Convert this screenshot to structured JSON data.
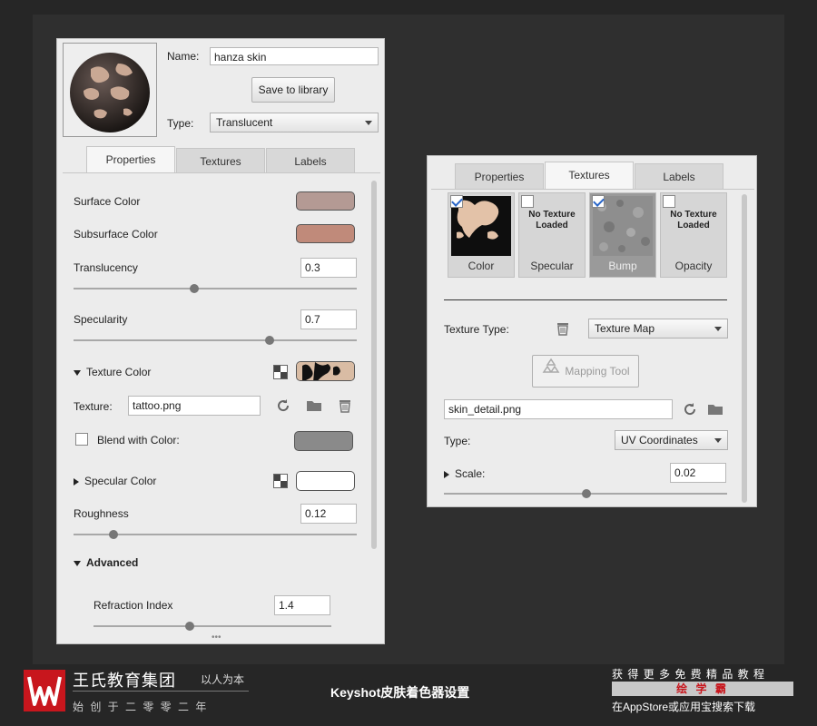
{
  "left_panel": {
    "name_label": "Name:",
    "name_value": "hanza skin",
    "save_button": "Save to library",
    "type_label": "Type:",
    "type_value": "Translucent",
    "tabs": [
      "Properties",
      "Textures",
      "Labels"
    ],
    "active_tab": "Properties",
    "surface_color": {
      "label": "Surface Color",
      "color": "#b49a94"
    },
    "subsurface_color": {
      "label": "Subsurface Color",
      "color": "#c08a7a"
    },
    "translucency": {
      "label": "Translucency",
      "value": "0.3",
      "slider": 0.42
    },
    "specularity": {
      "label": "Specularity",
      "value": "0.7",
      "slider": 0.7
    },
    "texture_color": {
      "label": "Texture Color"
    },
    "texture": {
      "label": "Texture:",
      "value": "tattoo.png"
    },
    "blend": {
      "label": "Blend with Color:",
      "color": "#8a8a8a"
    },
    "specular_color": {
      "label": "Specular Color",
      "color": "#ffffff"
    },
    "roughness": {
      "label": "Roughness",
      "value": "0.12",
      "slider": 0.14
    },
    "advanced": {
      "label": "Advanced"
    },
    "refraction": {
      "label": "Refraction Index",
      "value": "1.4",
      "slider": 0.41
    },
    "more": "•••"
  },
  "right_panel": {
    "tabs": [
      "Properties",
      "Textures",
      "Labels"
    ],
    "active_tab": "Textures",
    "tiles": [
      {
        "name": "Color",
        "checked": true,
        "loaded": true
      },
      {
        "name": "Specular",
        "checked": false,
        "loaded": false,
        "empty_text": "No Texture Loaded"
      },
      {
        "name": "Bump",
        "checked": true,
        "loaded": true
      },
      {
        "name": "Opacity",
        "checked": false,
        "loaded": false,
        "empty_text": "No Texture Loaded"
      }
    ],
    "texture_type_label": "Texture Type:",
    "texture_type_value": "Texture Map",
    "mapping_tool": "Mapping Tool",
    "file_value": "skin_detail.png",
    "type_label": "Type:",
    "type_value": "UV Coordinates",
    "scale": {
      "label": "Scale:",
      "value": "0.02",
      "slider": 0.51
    }
  },
  "footer": {
    "brand": "王氏教育集团",
    "motto": "以人为本",
    "founded": "始 创 于 二 零 零 二 年",
    "title": "Keyshot皮肤着色器设置",
    "promo_line1": "获 得 更 多 免 费 精 品 教 程",
    "promo_brand": "绘 学 霸",
    "promo_line2": "在AppStore或应用宝搜索下载"
  }
}
